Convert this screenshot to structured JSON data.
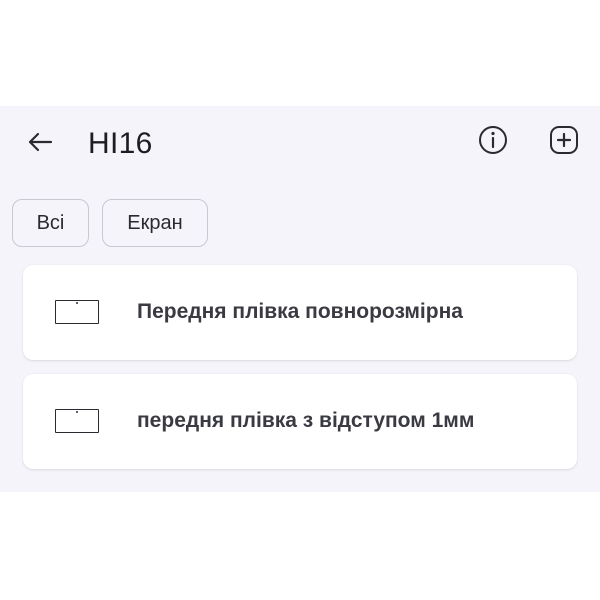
{
  "header": {
    "title": "HI16",
    "back_icon": "arrow-left-icon",
    "info_icon": "info-circle-icon",
    "add_icon": "plus-square-icon"
  },
  "filters": {
    "items": [
      {
        "label": "Всі"
      },
      {
        "label": "Екран"
      }
    ]
  },
  "list": {
    "items": [
      {
        "label": "Передня плівка повнорозмірна",
        "icon": "screen-rectangle-icon"
      },
      {
        "label": "передня плівка з відступом 1мм",
        "icon": "screen-rectangle-icon"
      }
    ]
  },
  "colors": {
    "panel_background": "#f4f4fa",
    "card_background": "#ffffff",
    "text_primary": "#1c1c22",
    "chip_border": "#c9c7d0"
  }
}
